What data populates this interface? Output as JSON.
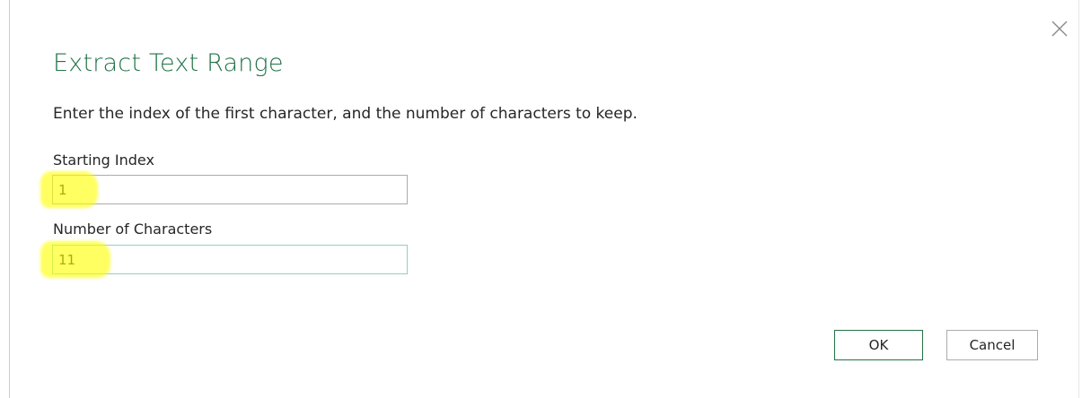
{
  "dialog": {
    "title": "Extract Text Range",
    "description": "Enter the index of the first character, and the number of characters to keep.",
    "close_icon": "close-icon",
    "accent_color": "#217346",
    "highlight_color": "#ffff00"
  },
  "fields": {
    "starting_index": {
      "label": "Starting Index",
      "value": "1"
    },
    "number_of_characters": {
      "label": "Number of Characters",
      "value": "11"
    }
  },
  "buttons": {
    "ok_label": "OK",
    "cancel_label": "Cancel"
  }
}
